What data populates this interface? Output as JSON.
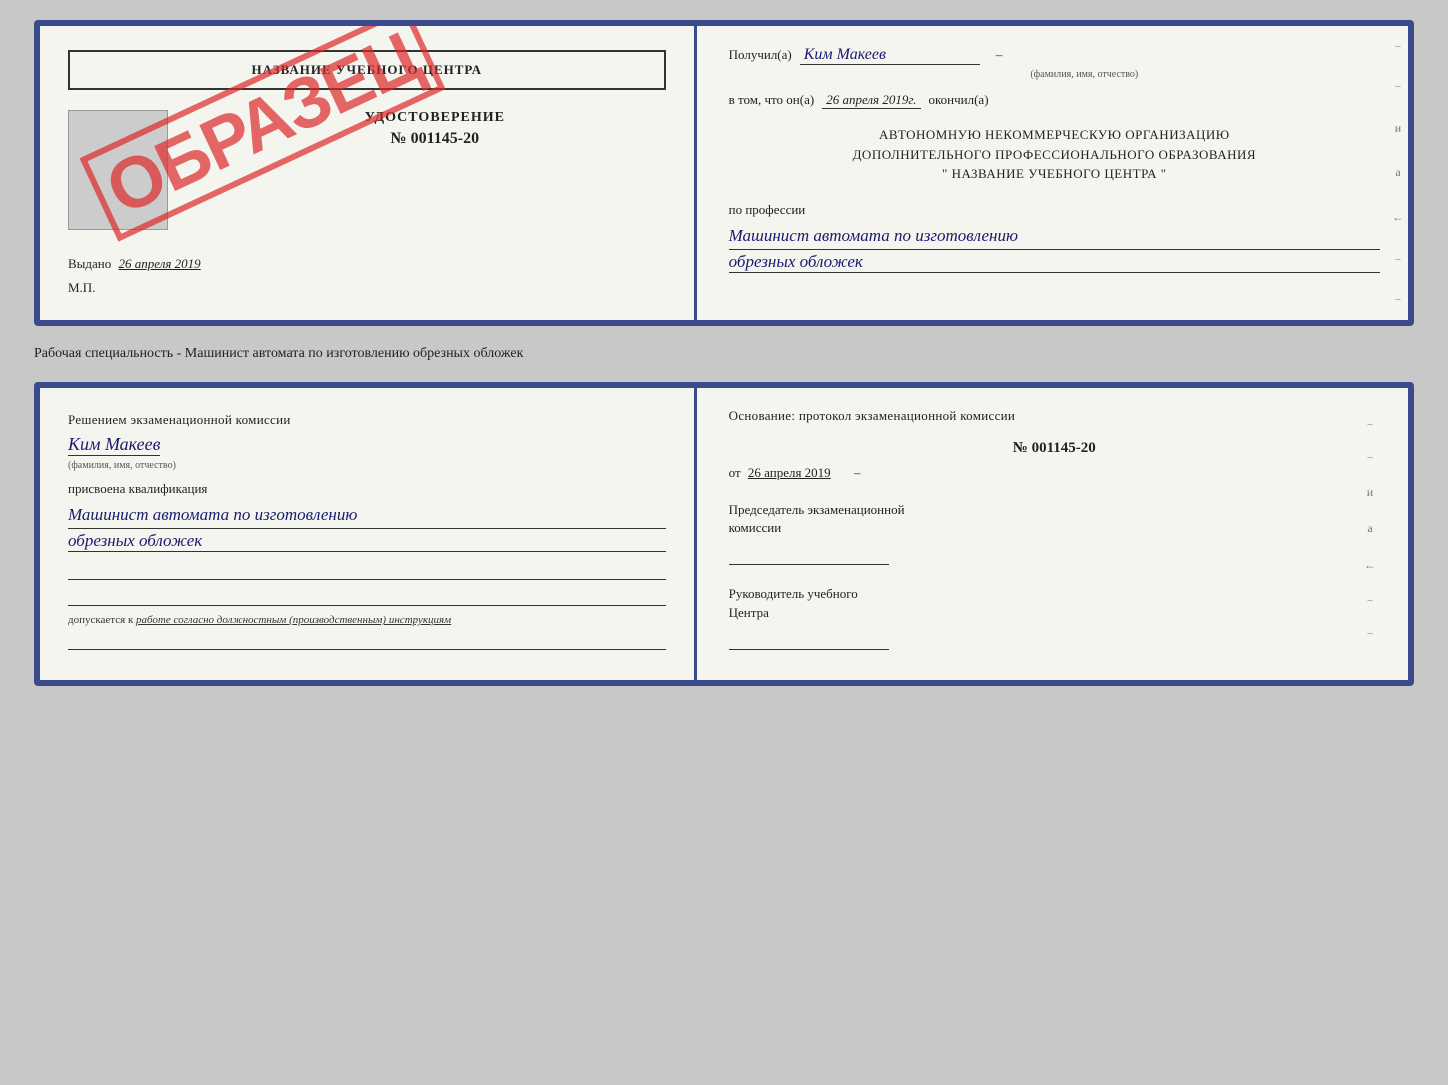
{
  "page": {
    "background": "#c8c8c8"
  },
  "top_document": {
    "left": {
      "center_name": "НАЗВАНИЕ УЧЕБНОГО ЦЕНТРА",
      "udostoverenie_label": "УДОСТОВЕРЕНИЕ",
      "number": "№ 001145-20",
      "vydano_label": "Выдано",
      "vydano_date": "26 апреля 2019",
      "mp_label": "М.П.",
      "stamp_text": "ОБРАЗЕЦ"
    },
    "right": {
      "poluchil_label": "Получил(а)",
      "poluchil_name": "Ким Макеев",
      "fio_sublabel": "(фамилия, имя, отчество)",
      "v_tom_label": "в том, что он(а)",
      "date_value": "26 апреля 2019г.",
      "okonchil_label": "окончил(а)",
      "org_line1": "АВТОНОМНУЮ НЕКОММЕРЧЕСКУЮ ОРГАНИЗАЦИЮ",
      "org_line2": "ДОПОЛНИТЕЛЬНОГО ПРОФЕССИОНАЛЬНОГО ОБРАЗОВАНИЯ",
      "org_line3": "\"  НАЗВАНИЕ УЧЕБНОГО ЦЕНТРА  \"",
      "po_professii_label": "по профессии",
      "profession_line1": "Машинист автомата по изготовлению",
      "profession_line2": "обрезных обложек",
      "side_chars": [
        "и",
        "а",
        "←",
        "–",
        "–",
        "–"
      ]
    }
  },
  "middle_caption": "Рабочая специальность - Машинист автомата по изготовлению обрезных обложек",
  "bottom_document": {
    "left": {
      "resheniem_text": "Решением экзаменационной комиссии",
      "fio_name": "Ким Макеев",
      "fio_sublabel": "(фамилия, имя, отчество)",
      "prisvoena_label": "присвоена квалификация",
      "kvali_line1": "Машинист автомата по изготовлению",
      "kvali_line2": "обрезных обложек",
      "dopuskaetsya_prefix": "допускается к",
      "dopuskaetsya_text": "работе согласно должностным (производственным) инструкциям"
    },
    "right": {
      "osnov_label": "Основание: протокол экзаменационной комиссии",
      "protocol_number": "№  001145-20",
      "date_ot_label": "от",
      "date_ot_value": "26 апреля 2019",
      "chairman_title1": "Председатель экзаменационной",
      "chairman_title2": "комиссии",
      "rukovod_title1": "Руководитель учебного",
      "rukovod_title2": "Центра",
      "side_chars": [
        "и",
        "а",
        "←",
        "–",
        "–",
        "–"
      ]
    }
  }
}
